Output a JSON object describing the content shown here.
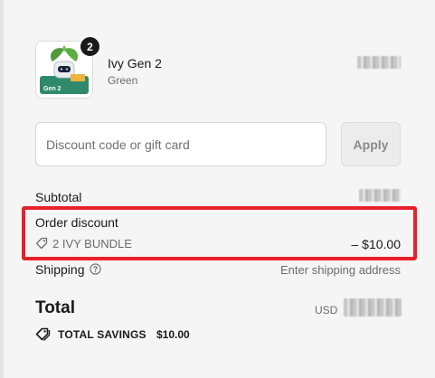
{
  "cart_item": {
    "name": "Ivy Gen 2",
    "variant": "Green",
    "quantity": "2",
    "image_caption": "Gen 2",
    "price_obscured": true
  },
  "discount": {
    "placeholder": "Discount code or gift card",
    "apply_label": "Apply"
  },
  "summary": {
    "subtotal_label": "Subtotal",
    "order_discount_label": "Order discount",
    "discount_code": "2 IVY BUNDLE",
    "discount_amount": "– $10.00",
    "shipping_label": "Shipping",
    "shipping_value": "Enter shipping address",
    "total_label": "Total",
    "currency": "USD",
    "savings_label": "TOTAL SAVINGS",
    "savings_value": "$10.00"
  },
  "colors": {
    "highlight": "#e8202a",
    "text": "#1a1a1a",
    "muted": "#6b6b6b"
  }
}
